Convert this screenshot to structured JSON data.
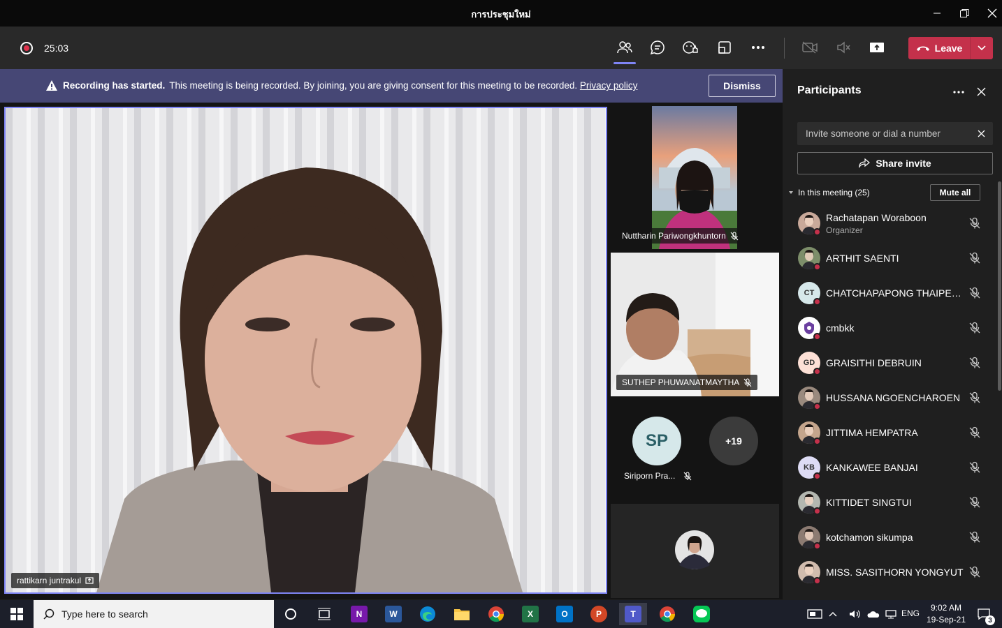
{
  "window": {
    "title": "การประชุมใหม่"
  },
  "toolbar": {
    "timer": "25:03",
    "leave_label": "Leave"
  },
  "banner": {
    "title": "Recording has started.",
    "message": "This meeting is being recorded. By joining, you are giving consent for this meeting to be recorded.",
    "link": "Privacy policy",
    "dismiss_label": "Dismiss"
  },
  "stage": {
    "main_name": "rattikarn juntrakul",
    "tiles": [
      {
        "name": "Nuttharin Pariwongkhuntorn"
      },
      {
        "name": "SUTHEP PHUWANATMAYTHA"
      },
      {
        "initials": "SP",
        "name": "Siriporn Pra..."
      }
    ],
    "overflow_count": "+19"
  },
  "participants": {
    "title": "Participants",
    "invite_placeholder": "Invite someone or dial a number",
    "share_label": "Share invite",
    "section_label": "In this meeting (25)",
    "mute_all_label": "Mute all",
    "list": [
      {
        "name": "Rachatapan Woraboon",
        "role": "Organizer",
        "avatar": "photo",
        "initials": "",
        "color": "#c9a99a"
      },
      {
        "name": "ARTHIT SAENTI",
        "role": "",
        "avatar": "photo",
        "initials": "",
        "color": "#7d8e6a"
      },
      {
        "name": "CHATCHAPAPONG THAIPETK...",
        "role": "",
        "avatar": "initials",
        "initials": "CT",
        "color": "#d6e8ea"
      },
      {
        "name": "cmbkk",
        "role": "",
        "avatar": "logo",
        "initials": "",
        "color": "#ffffff"
      },
      {
        "name": "GRAISITHI DEBRUIN",
        "role": "",
        "avatar": "initials",
        "initials": "GD",
        "color": "#fde0d6"
      },
      {
        "name": "HUSSANA NGOENCHAROEN",
        "role": "",
        "avatar": "photo",
        "initials": "",
        "color": "#9a8a7e"
      },
      {
        "name": "JITTIMA HEMPATRA",
        "role": "",
        "avatar": "photo",
        "initials": "",
        "color": "#c4a58c"
      },
      {
        "name": "KANKAWEE BANJAI",
        "role": "",
        "avatar": "initials",
        "initials": "KB",
        "color": "#dedcf5"
      },
      {
        "name": "KITTIDET SINGTUI",
        "role": "",
        "avatar": "photo",
        "initials": "",
        "color": "#b3b7b0"
      },
      {
        "name": "kotchamon sikumpa",
        "role": "",
        "avatar": "photo",
        "initials": "",
        "color": "#8c7b72"
      },
      {
        "name": "MISS. SASITHORN YONGYUT",
        "role": "",
        "avatar": "photo",
        "initials": "",
        "color": "#d1bcae"
      }
    ]
  },
  "taskbar": {
    "search_placeholder": "Type here to search",
    "language": "ENG",
    "time": "9:02 AM",
    "date": "19-Sep-21",
    "notification_count": "3"
  }
}
